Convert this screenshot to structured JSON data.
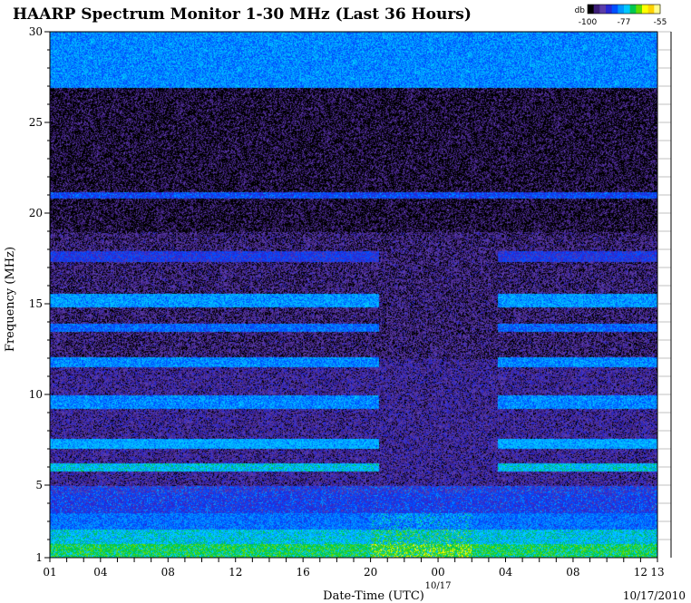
{
  "chart_data": {
    "type": "heatmap",
    "title": "HAARP Spectrum Monitor 1-30 MHz (Last 36 Hours)",
    "xlabel": "Date-Time (UTC)",
    "ylabel": "Frequency (MHz)",
    "x_ticks": [
      "01",
      "04",
      "08",
      "12",
      "16",
      "20",
      "00",
      "04",
      "08",
      "12",
      "13"
    ],
    "x_tick_hours": [
      0,
      3,
      7,
      11,
      15,
      19,
      23,
      27,
      31,
      35,
      36
    ],
    "x_range_hours": [
      0,
      36
    ],
    "date_marker": "10/17",
    "date_marker_hour": 23,
    "date_stamp": "10/17/2010",
    "y_ticks": [
      1,
      5,
      10,
      15,
      20,
      25,
      30
    ],
    "ylim": [
      1,
      30
    ],
    "grid": true,
    "colorbar": {
      "unit": "db",
      "labels": [
        "-100",
        "-77",
        "-55"
      ],
      "min": -100,
      "max": -55,
      "colors": [
        "#000000",
        "#3c1e78",
        "#5a3ca8",
        "#2828d2",
        "#0050ff",
        "#0096ff",
        "#00c8ff",
        "#00c850",
        "#64dc00",
        "#ffff00",
        "#ffd200",
        "#ffff8c"
      ]
    },
    "bands": [
      {
        "freq": 1.3,
        "width": 0.5,
        "level": -72
      },
      {
        "freq": 2.0,
        "width": 0.6,
        "level": -76
      },
      {
        "freq": 3.0,
        "width": 0.5,
        "level": -82
      },
      {
        "freq": 4.0,
        "width": 0.6,
        "level": -88
      },
      {
        "freq": 6.0,
        "width": 0.25,
        "level": -76
      },
      {
        "freq": 7.3,
        "width": 0.25,
        "level": -78
      },
      {
        "freq": 9.6,
        "width": 0.35,
        "level": -80
      },
      {
        "freq": 11.8,
        "width": 0.3,
        "level": -80
      },
      {
        "freq": 13.7,
        "width": 0.2,
        "level": -82
      },
      {
        "freq": 15.2,
        "width": 0.4,
        "level": -79
      },
      {
        "freq": 17.6,
        "width": 0.3,
        "level": -86
      },
      {
        "freq": 21.0,
        "width": 0.15,
        "level": -84
      },
      {
        "freq": 28.5,
        "width": 1.6,
        "level": -80
      }
    ]
  }
}
